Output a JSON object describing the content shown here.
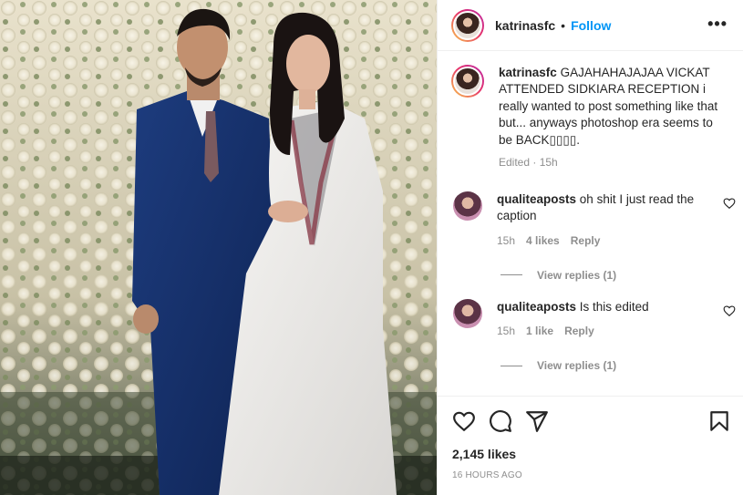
{
  "post": {
    "username": "katrinasfc",
    "separator": "•",
    "follow_label": "Follow",
    "more_label": "•••",
    "caption": {
      "username": "katrinasfc",
      "text": "GAJAHAHAJAJAA VICKAT ATTENDED SIDKIARA RECEPTION i really wanted to post something like that but... anyways photoshop era seems to be BACK▯▯▯▯.",
      "meta": "Edited · 15h"
    },
    "comments": [
      {
        "username": "qualiteaposts",
        "text": "oh shit I just read the caption",
        "time": "15h",
        "likes": "4 likes",
        "reply_label": "Reply",
        "view_replies": "View replies (1)"
      },
      {
        "username": "qualiteaposts",
        "text": "Is this edited",
        "time": "15h",
        "likes": "1 like",
        "reply_label": "Reply",
        "view_replies": "View replies (1)"
      }
    ],
    "likes_count": "2,145 likes",
    "posted_ago": "16 HOURS AGO",
    "icons": [
      "heart-icon",
      "comment-icon",
      "share-icon",
      "bookmark-icon"
    ]
  },
  "colors": {
    "link_blue": "#0095f6",
    "muted_text": "#8e8e8e",
    "primary_text": "#262626",
    "divider": "#efefef"
  }
}
